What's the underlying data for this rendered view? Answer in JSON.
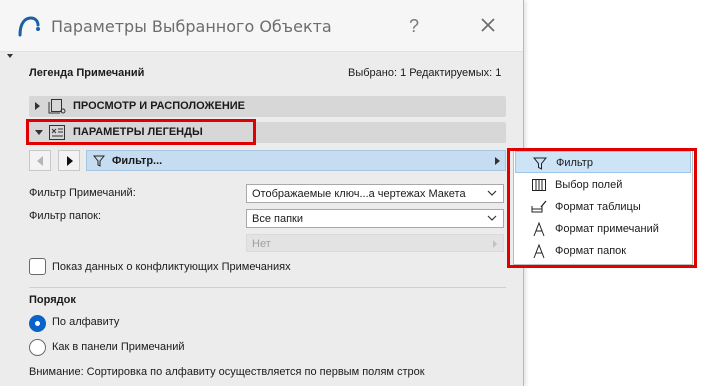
{
  "window": {
    "title": "Параметры Выбранного Объекта",
    "help_label": "?"
  },
  "object": {
    "name": "Легенда Примечаний",
    "selected_info": "Выбрано: 1 Редактируемых: 1"
  },
  "sections": [
    {
      "label": "ПРОСМОТР И РАСПОЛОЖЕНИЕ",
      "expanded": false,
      "icon": "layout-icon"
    },
    {
      "label": "ПАРАМЕТРЫ ЛЕГЕНДЫ",
      "expanded": true,
      "icon": "legend-settings-icon"
    }
  ],
  "panel_nav": {
    "current": "Фильтр..."
  },
  "fields": {
    "notes_filter_label": "Фильтр Примечаний:",
    "notes_filter_value": "Отображаемые ключ...а чертежах Макета",
    "folder_filter_label": "Фильтр папок:",
    "folder_filter_value": "Все папки",
    "disabled_value": "Нет"
  },
  "conflict_checkbox": {
    "label": "Показ данных о конфликтующих Примечаниях",
    "checked": false
  },
  "order": {
    "title": "Порядок",
    "options": [
      {
        "label": "По алфавиту",
        "selected": true
      },
      {
        "label": "Как в панели Примечаний",
        "selected": false
      }
    ],
    "note": "Внимание: Сортировка по алфавиту осуществляется по первым полям строк"
  },
  "popup_menu": {
    "items": [
      {
        "label": "Фильтр",
        "icon": "filter-icon",
        "selected": true
      },
      {
        "label": "Выбор полей",
        "icon": "columns-icon",
        "selected": false
      },
      {
        "label": "Формат таблицы",
        "icon": "table-format-icon",
        "selected": false
      },
      {
        "label": "Формат примечаний",
        "icon": "text-format-icon",
        "selected": false
      },
      {
        "label": "Формат папок",
        "icon": "folder-format-icon",
        "selected": false
      }
    ]
  },
  "colors": {
    "highlight": "#e00000",
    "accent": "#0a63c8",
    "selection": "#c5dcf1"
  }
}
